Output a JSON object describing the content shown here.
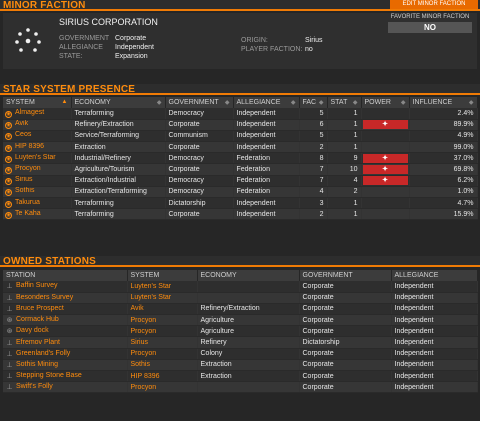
{
  "minor_faction": {
    "section_title": "MINOR FACTION",
    "edit_button": "EDIT MINOR FACTION",
    "name": "SIRIUS CORPORATION",
    "government_label": "GOVERNMENT",
    "government": "Corporate",
    "allegiance_label": "ALLEGIANCE",
    "allegiance": "Independent",
    "state_label": "STATE:",
    "state": "Expansion",
    "origin_label": "ORIGIN:",
    "origin": "Sirius",
    "player_faction_label": "PLAYER FACTION:",
    "player_faction": "no",
    "favorite_label": "FAVORITE MINOR FACTION",
    "favorite_value": "NO"
  },
  "star_system_presence": {
    "section_title": "STAR SYSTEM PRESENCE",
    "columns": [
      "SYSTEM",
      "ECONOMY",
      "GOVERNMENT",
      "ALLEGIANCE",
      "FAC",
      "STAT",
      "POWER",
      "INFLUENCE"
    ],
    "rows": [
      {
        "system": "Almagest",
        "economy": "Terraforming",
        "government": "Democracy",
        "allegiance": "Independent",
        "fac": "5",
        "stat": "1",
        "power": "",
        "influence": "2.4%"
      },
      {
        "system": "Avik",
        "economy": "Refinery/Extraction",
        "government": "Corporate",
        "allegiance": "Independent",
        "fac": "6",
        "stat": "1",
        "power": "power-emblem",
        "influence": "89.9%"
      },
      {
        "system": "Ceos",
        "economy": "Service/Terraforming",
        "government": "Communism",
        "allegiance": "Independent",
        "fac": "5",
        "stat": "1",
        "power": "",
        "influence": "4.9%"
      },
      {
        "system": "HIP 8396",
        "economy": "Extraction",
        "government": "Corporate",
        "allegiance": "Independent",
        "fac": "2",
        "stat": "1",
        "power": "",
        "influence": "99.0%"
      },
      {
        "system": "Luyten's Star",
        "economy": "Industrial/Refinery",
        "government": "Democracy",
        "allegiance": "Federation",
        "fac": "8",
        "stat": "9",
        "power": "power-emblem",
        "influence": "37.0%"
      },
      {
        "system": "Procyon",
        "economy": "Agriculture/Tourism",
        "government": "Corporate",
        "allegiance": "Federation",
        "fac": "7",
        "stat": "10",
        "power": "power-emblem",
        "influence": "69.8%"
      },
      {
        "system": "Sirius",
        "economy": "Extraction/Industrial",
        "government": "Democracy",
        "allegiance": "Federation",
        "fac": "7",
        "stat": "4",
        "power": "power-emblem",
        "influence": "6.2%"
      },
      {
        "system": "Sothis",
        "economy": "Extraction/Terraforming",
        "government": "Democracy",
        "allegiance": "Federation",
        "fac": "4",
        "stat": "2",
        "power": "",
        "influence": "1.0%"
      },
      {
        "system": "Takurua",
        "economy": "Terraforming",
        "government": "Dictatorship",
        "allegiance": "Independent",
        "fac": "3",
        "stat": "1",
        "power": "",
        "influence": "4.7%"
      },
      {
        "system": "Te Kaha",
        "economy": "Terraforming",
        "government": "Corporate",
        "allegiance": "Independent",
        "fac": "2",
        "stat": "1",
        "power": "",
        "influence": "15.9%"
      }
    ]
  },
  "owned_stations": {
    "section_title": "OWNED STATIONS",
    "columns": [
      "STATION",
      "SYSTEM",
      "ECONOMY",
      "GOVERNMENT",
      "ALLEGIANCE"
    ],
    "rows": [
      {
        "icon": "outpost-icon",
        "station": "Baffin Survey",
        "system": "Luyten's Star",
        "economy": "",
        "government": "Corporate",
        "allegiance": "Independent"
      },
      {
        "icon": "outpost-icon",
        "station": "Besonders Survey",
        "system": "Luyten's Star",
        "economy": "",
        "government": "Corporate",
        "allegiance": "Independent"
      },
      {
        "icon": "outpost-icon",
        "station": "Bruce Prospect",
        "system": "Avik",
        "economy": "Refinery/Extraction",
        "government": "Corporate",
        "allegiance": "Independent"
      },
      {
        "icon": "starport-icon",
        "station": "Cormack Hub",
        "system": "Procyon",
        "economy": "Agriculture",
        "government": "Corporate",
        "allegiance": "Independent"
      },
      {
        "icon": "starport-icon",
        "station": "Davy dock",
        "system": "Procyon",
        "economy": "Agriculture",
        "government": "Corporate",
        "allegiance": "Independent"
      },
      {
        "icon": "outpost-icon",
        "station": "Efremov Plant",
        "system": "Sirius",
        "economy": "Refinery",
        "government": "Dictatorship",
        "allegiance": "Independent"
      },
      {
        "icon": "outpost-icon",
        "station": "Greenland's Folly",
        "system": "Procyon",
        "economy": "Colony",
        "government": "Corporate",
        "allegiance": "Independent"
      },
      {
        "icon": "outpost-icon",
        "station": "Sothis Mining",
        "system": "Sothis",
        "economy": "Extraction",
        "government": "Corporate",
        "allegiance": "Independent"
      },
      {
        "icon": "outpost-icon",
        "station": "Stepping Stone Base",
        "system": "HIP 8396",
        "economy": "Extraction",
        "government": "Corporate",
        "allegiance": "Independent"
      },
      {
        "icon": "outpost-icon",
        "station": "Swift's Folly",
        "system": "Procyon",
        "economy": "",
        "government": "Corporate",
        "allegiance": "Independent"
      }
    ]
  },
  "colors": {
    "accent": "#ff8c0d",
    "power": "#c82828",
    "background": "#262626"
  }
}
